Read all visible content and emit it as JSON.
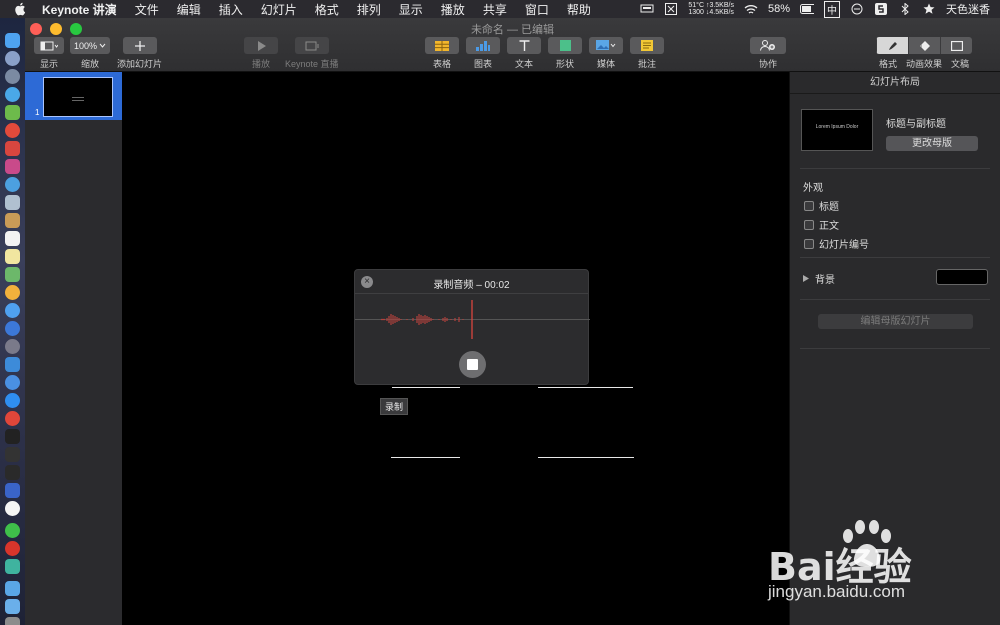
{
  "menubar": {
    "items": [
      "Keynote 讲演",
      "文件",
      "编辑",
      "插入",
      "幻灯片",
      "格式",
      "排列",
      "显示",
      "播放",
      "共享",
      "窗口",
      "帮助"
    ],
    "status": {
      "temp": "51°C",
      "net_up": "↑3.5KB/s",
      "rpm": "1300",
      "net_down": "↓4.5KB/s",
      "battery": "58%",
      "input": "中",
      "user": "天色迷香"
    }
  },
  "window": {
    "title": "未命名 — 已编辑"
  },
  "toolbar": {
    "view_label": "显示",
    "zoom_value": "100%",
    "zoom_label": "缩放",
    "add_slide_label": "添加幻灯片",
    "play_label": "播放",
    "live_label": "Keynote 直播",
    "table_label": "表格",
    "chart_label": "图表",
    "text_label": "文本",
    "shape_label": "形状",
    "media_label": "媒体",
    "comment_label": "批注",
    "collab_label": "协作",
    "format_label": "格式",
    "animate_label": "动画效果",
    "document_label": "文稿"
  },
  "navigator": {
    "slide_number": "1"
  },
  "recording": {
    "title": "录制音频 – 00:02",
    "tooltip": "录制"
  },
  "inspector": {
    "header": "幻灯片布局",
    "master_thumb_text": "Lorem Ipsum Dolor",
    "master_name": "标题与副标题",
    "change_master": "更改母版",
    "appearance_title": "外观",
    "checkboxes": [
      "标题",
      "正文",
      "幻灯片编号"
    ],
    "background_label": "背景",
    "edit_master": "编辑母版幻灯片",
    "background_color": "#000000"
  },
  "watermark": {
    "brand": "Bai经验",
    "url": "jingyan.baidu.com"
  }
}
